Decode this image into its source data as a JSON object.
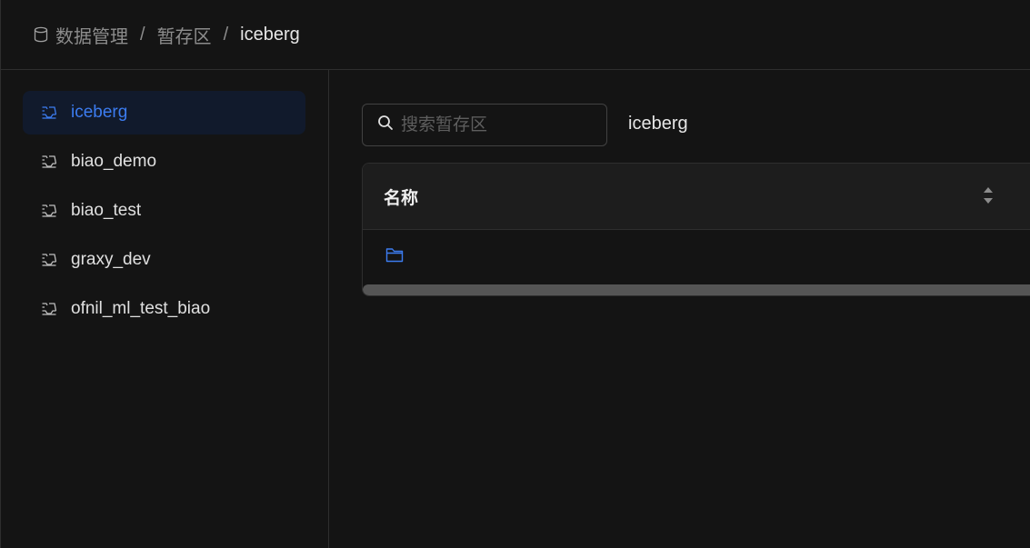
{
  "breadcrumb": {
    "icon": "database-icon",
    "items": [
      "数据管理",
      "暂存区",
      "iceberg"
    ],
    "separator": "/"
  },
  "sidebar": {
    "items": [
      {
        "label": "iceberg",
        "icon": "stage-icon",
        "active": true
      },
      {
        "label": "biao_demo",
        "icon": "stage-icon",
        "active": false
      },
      {
        "label": "biao_test",
        "icon": "stage-icon",
        "active": false
      },
      {
        "label": "graxy_dev",
        "icon": "stage-icon",
        "active": false
      },
      {
        "label": "ofnil_ml_test_biao",
        "icon": "stage-icon",
        "active": false
      }
    ]
  },
  "search": {
    "placeholder": "搜索暂存区",
    "value": ""
  },
  "current_stage": "iceberg",
  "table": {
    "columns": [
      "名称"
    ],
    "rows": [
      {
        "icon": "folder-icon",
        "name": ""
      }
    ]
  },
  "colors": {
    "accent": "#3c7cf0",
    "background": "#141414",
    "active_bg": "#111a2c"
  }
}
